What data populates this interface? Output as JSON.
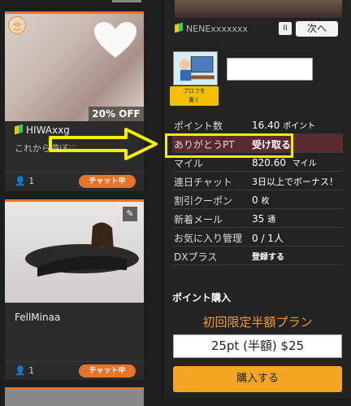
{
  "cards": [
    {
      "name": "HIWAxxg",
      "message": "これから遊ぼ♡",
      "discount": "20% OFF",
      "users": "1",
      "chat_label": "チャット中"
    },
    {
      "name": "FellMinaa",
      "message": "",
      "users": "1",
      "chat_label": "チャット中"
    }
  ],
  "performer": {
    "name": "NENExxxxxxx",
    "pause_label": "II",
    "next_label": "次へ",
    "profile_label_1": "プロフを",
    "profile_label_2": "書く"
  },
  "info": {
    "points_label": "ポイント数",
    "points_value": "16.40",
    "points_unit": "ポイント",
    "thanks_label": "ありがとうPT",
    "thanks_value": "受け取る",
    "miles_label": "マイル",
    "miles_value": "820.60",
    "miles_unit": "マイル",
    "streak_label": "連日チャット",
    "streak_value": "3日以上でボーナス！",
    "coupon_label": "割引クーポン",
    "coupon_value": "0",
    "coupon_unit": "枚",
    "mail_label": "新着メール",
    "mail_value": "35",
    "mail_unit": "通",
    "favorite_label": "お気に入り管理",
    "favorite_value": "0 / 1人",
    "dx_label": "DXプラス",
    "dx_value": "登録する"
  },
  "purchase": {
    "title": "ポイント購入",
    "plan_label": "初回限定半額プラン",
    "plan_option": "25pt (半額) $25",
    "buy_label": "購入する"
  },
  "colors": {
    "accent": "#e8742a",
    "highlight": "#f5ee00",
    "buy": "#f4a623",
    "plan_text": "#f19a3e"
  }
}
